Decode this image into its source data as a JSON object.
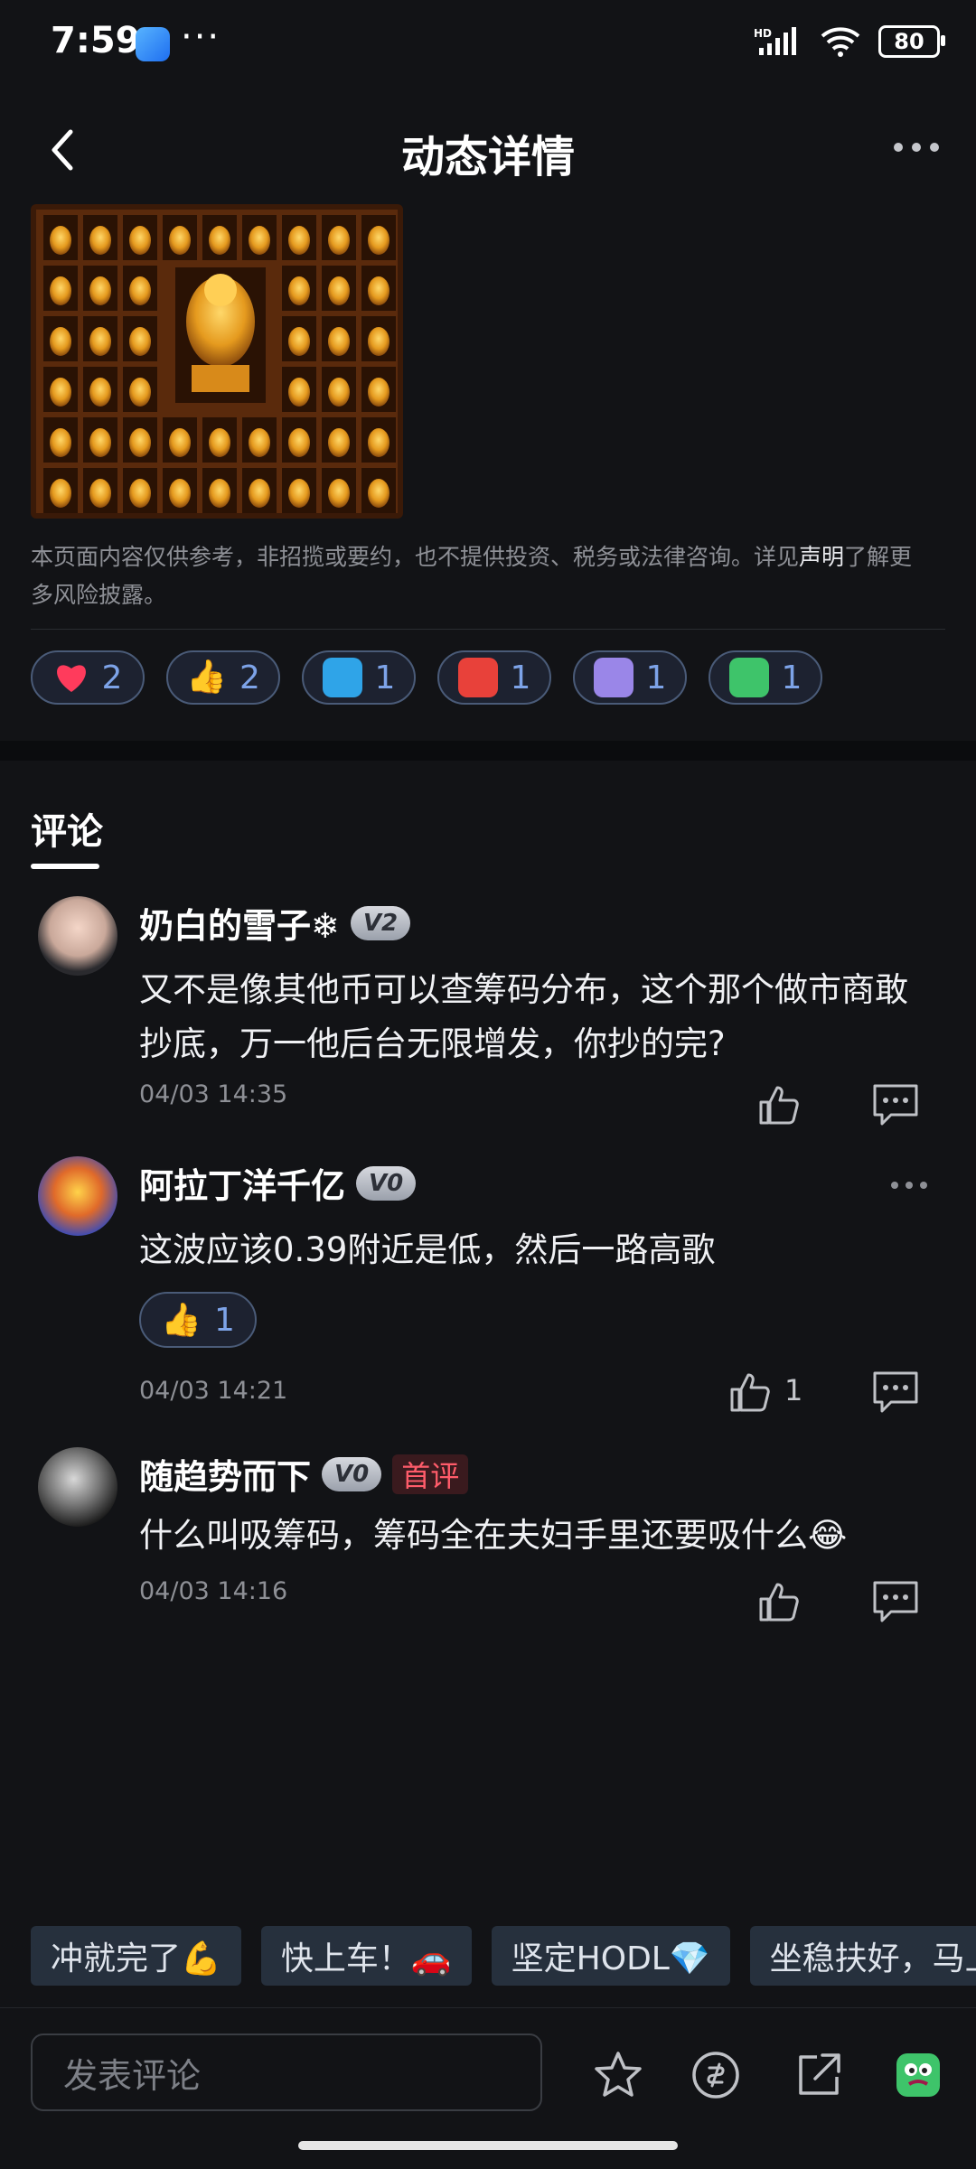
{
  "status": {
    "time": "7:59",
    "battery": "80",
    "network": "HD"
  },
  "header": {
    "title": "动态详情"
  },
  "disclaimer": {
    "text": "本页面内容仅供参考，非招揽或要约，也不提供投资、税务或法律咨询。详见",
    "link": "声明",
    "suffix": "了解更多风险披露。"
  },
  "reactions": [
    {
      "icon": "heart-icon",
      "count": "2"
    },
    {
      "icon": "thumbs-up-icon",
      "count": "2"
    },
    {
      "icon": "hodl-mascot-icon",
      "count": "1"
    },
    {
      "icon": "angry-mascot-icon",
      "count": "1"
    },
    {
      "icon": "purple-mascot-icon",
      "count": "1"
    },
    {
      "icon": "green-mascot-icon",
      "count": "1"
    }
  ],
  "comments_tab": {
    "label": "评论"
  },
  "comments": [
    {
      "name": "奶白的雪子❄",
      "level": "V2",
      "text": "又不是像其他币可以查筹码分布，这个那个做市商敢抄底，万一他后台无限增发，你抄的完?",
      "time": "04/03 14:35"
    },
    {
      "name": "阿拉丁洋千亿",
      "level": "V0",
      "text": "这波应该0.39附近是低，然后一路高歌",
      "reaction_count": "1",
      "time": "04/03 14:21",
      "like_count": "1"
    },
    {
      "name": "随趋势而下",
      "level": "V0",
      "badge": "首评",
      "text": "什么叫吸筹码，筹码全在夫妇手里还要吸什么😂",
      "time": "04/03 14:16"
    }
  ],
  "quick_replies": [
    "冲就完了💪",
    "快上车！🚗",
    "坚定HODL💎",
    "坐稳扶好，马上"
  ],
  "bottom": {
    "input_placeholder": "发表评论"
  },
  "colors": {
    "accent": "#7da3e8",
    "background": "#121316",
    "badge_red": "#ff5c6a"
  }
}
